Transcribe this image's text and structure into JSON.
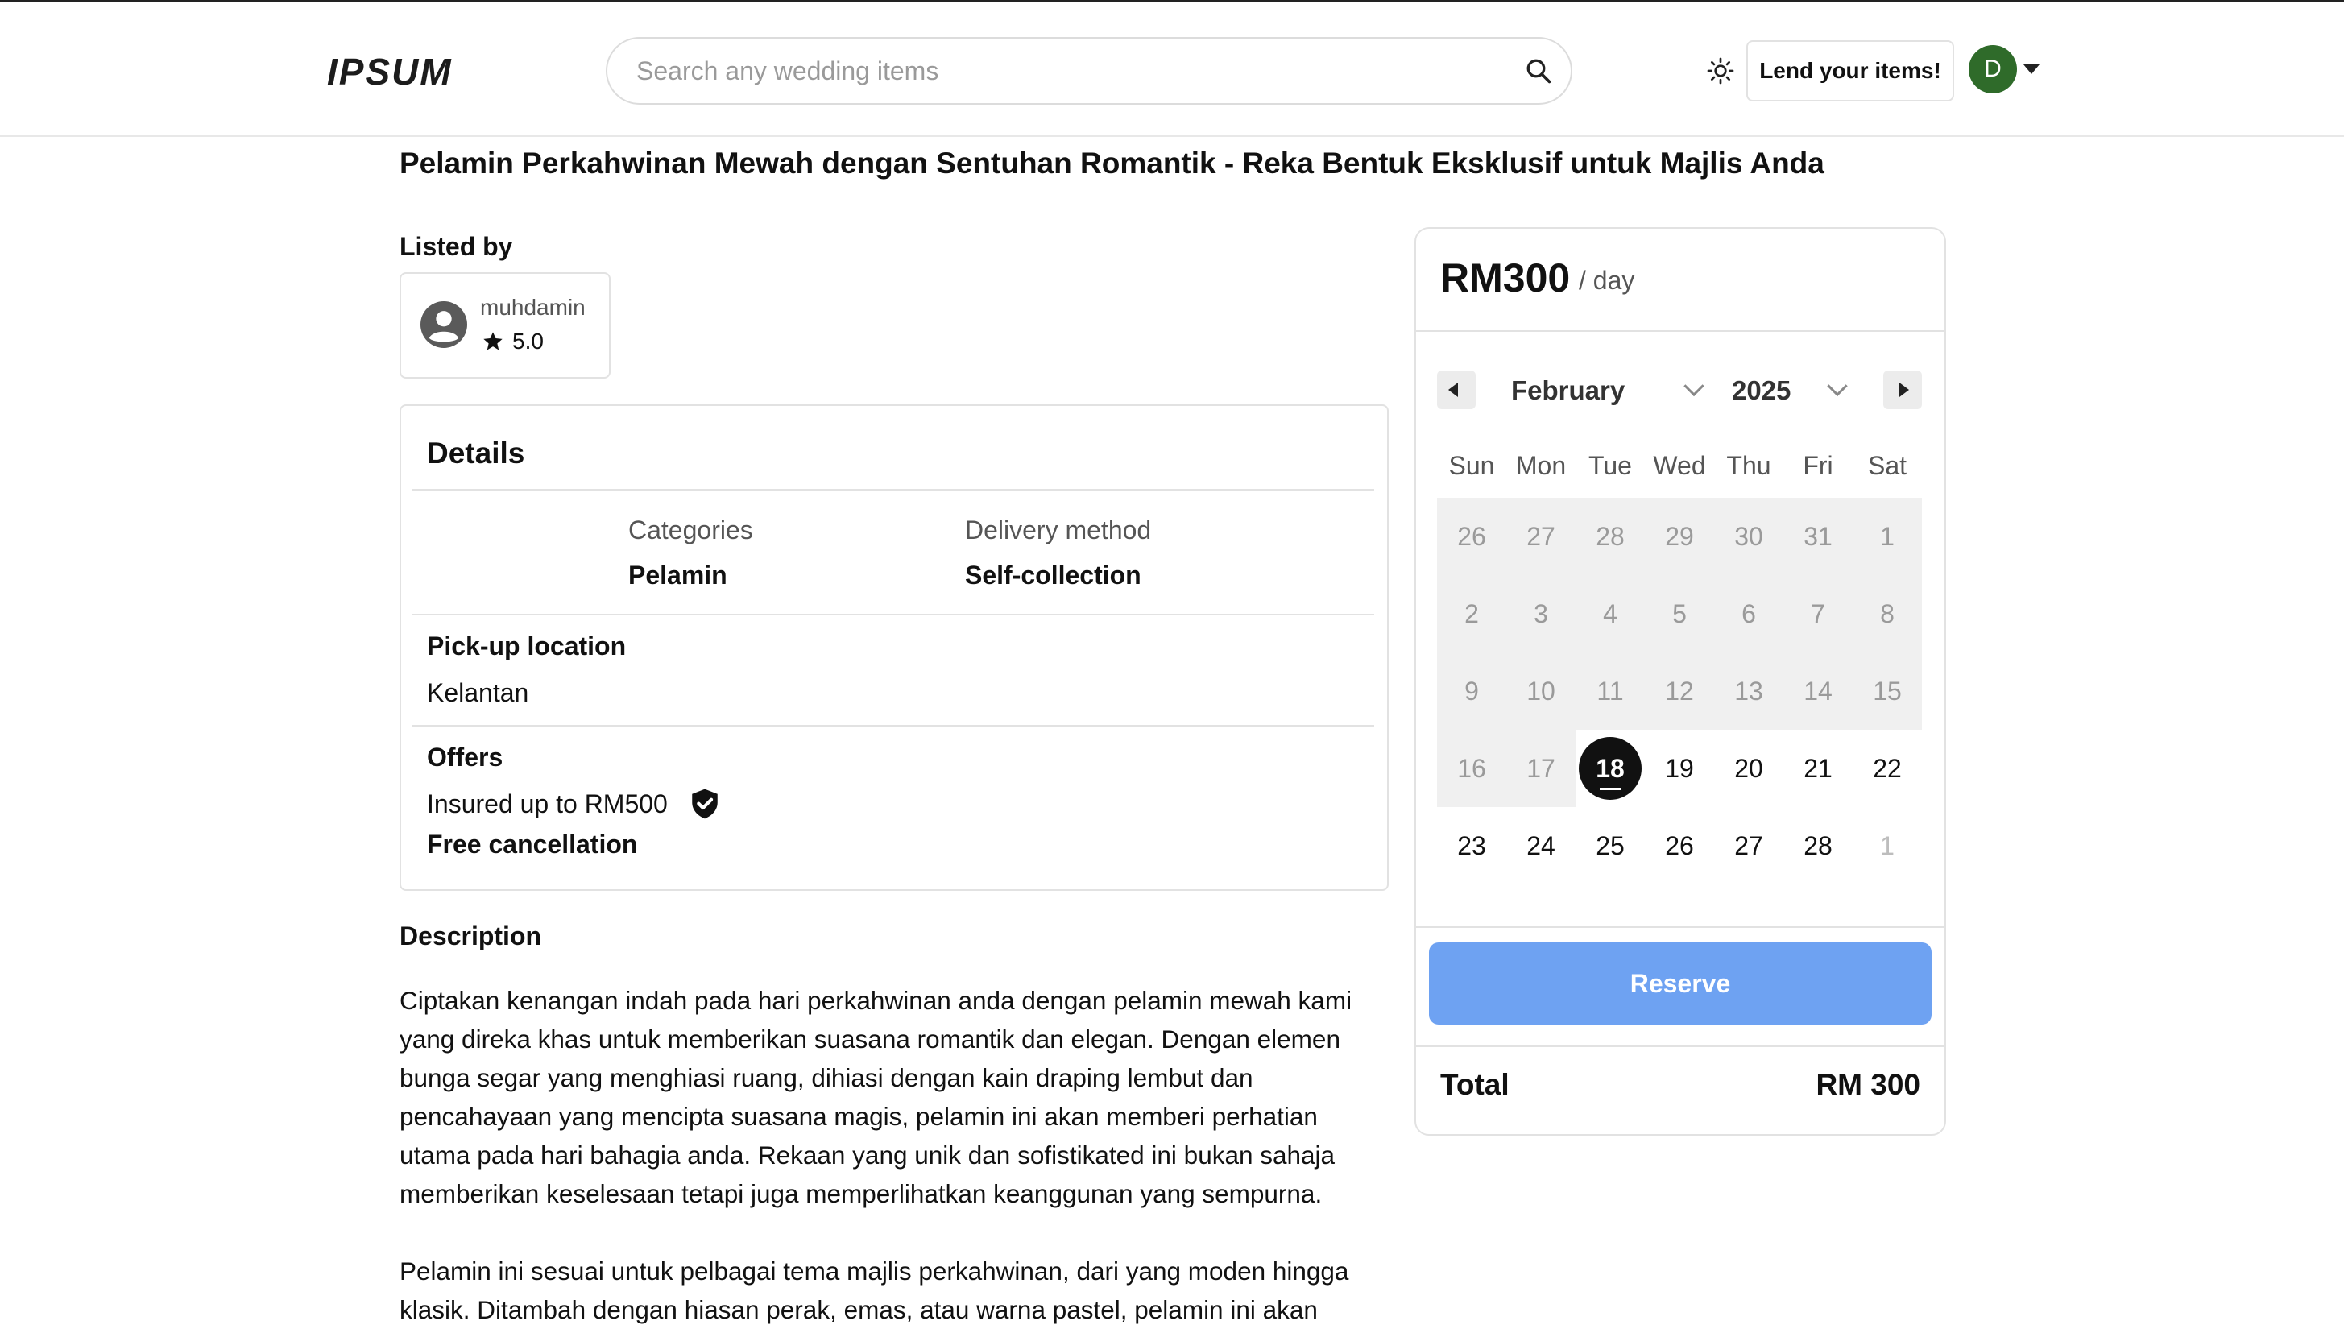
{
  "header": {
    "logo": "IPSUM",
    "search_placeholder": "Search any wedding items",
    "lend_label": "Lend your items!",
    "avatar_initial": "D"
  },
  "listing": {
    "title": "Pelamin Perkahwinan Mewah dengan Sentuhan Romantik - Reka Bentuk Eksklusif untuk Majlis Anda",
    "listed_by_label": "Listed by",
    "owner": {
      "name": "muhdamin",
      "rating": "5.0"
    },
    "details": {
      "title": "Details",
      "categories_label": "Categories",
      "categories_value": "Pelamin",
      "delivery_label": "Delivery method",
      "delivery_value": "Self-collection",
      "pickup_label": "Pick-up location",
      "pickup_value": "Kelantan",
      "offers_label": "Offers",
      "insured_text": "Insured up to RM500",
      "free_cancel_text": "Free cancellation"
    },
    "description": {
      "label": "Description",
      "p1": "Ciptakan kenangan indah pada hari perkahwinan anda dengan pelamin mewah kami yang direka khas untuk memberikan suasana romantik dan elegan. Dengan elemen bunga segar yang menghiasi ruang, dihiasi dengan kain draping lembut dan pencahayaan yang mencipta suasana magis, pelamin ini akan memberi perhatian utama pada hari bahagia anda. Rekaan yang unik dan sofistikated ini bukan sahaja memberikan keselesaan tetapi juga memperlihatkan keanggunan yang sempurna.",
      "p2": "Pelamin ini sesuai untuk pelbagai tema majlis perkahwinan, dari yang moden hingga klasik. Ditambah dengan hiasan perak, emas, atau warna pastel, pelamin ini akan"
    }
  },
  "booking": {
    "price": "RM300",
    "per_day": "/ day",
    "month": "February",
    "year": "2025",
    "weekdays": [
      "Sun",
      "Mon",
      "Tue",
      "Wed",
      "Thu",
      "Fri",
      "Sat"
    ],
    "days": [
      [
        {
          "d": "26",
          "s": "dis"
        },
        {
          "d": "27",
          "s": "dis"
        },
        {
          "d": "28",
          "s": "dis"
        },
        {
          "d": "29",
          "s": "dis"
        },
        {
          "d": "30",
          "s": "dis"
        },
        {
          "d": "31",
          "s": "dis"
        },
        {
          "d": "1",
          "s": "dis"
        }
      ],
      [
        {
          "d": "2",
          "s": "dis"
        },
        {
          "d": "3",
          "s": "dis"
        },
        {
          "d": "4",
          "s": "dis"
        },
        {
          "d": "5",
          "s": "dis"
        },
        {
          "d": "6",
          "s": "dis"
        },
        {
          "d": "7",
          "s": "dis"
        },
        {
          "d": "8",
          "s": "dis"
        }
      ],
      [
        {
          "d": "9",
          "s": "dis"
        },
        {
          "d": "10",
          "s": "dis"
        },
        {
          "d": "11",
          "s": "dis"
        },
        {
          "d": "12",
          "s": "dis"
        },
        {
          "d": "13",
          "s": "dis"
        },
        {
          "d": "14",
          "s": "dis"
        },
        {
          "d": "15",
          "s": "dis"
        }
      ],
      [
        {
          "d": "16",
          "s": "dis"
        },
        {
          "d": "17",
          "s": "dis"
        },
        {
          "d": "18",
          "s": "selected"
        },
        {
          "d": "19",
          "s": "avail"
        },
        {
          "d": "20",
          "s": "avail"
        },
        {
          "d": "21",
          "s": "avail"
        },
        {
          "d": "22",
          "s": "avail"
        }
      ],
      [
        {
          "d": "23",
          "s": "avail"
        },
        {
          "d": "24",
          "s": "avail"
        },
        {
          "d": "25",
          "s": "avail"
        },
        {
          "d": "26",
          "s": "avail"
        },
        {
          "d": "27",
          "s": "avail"
        },
        {
          "d": "28",
          "s": "avail"
        },
        {
          "d": "1",
          "s": "other"
        }
      ]
    ],
    "reserve_label": "Reserve",
    "total_label": "Total",
    "total_value": "RM 300",
    "reserve_color": "#6ea2f2"
  }
}
